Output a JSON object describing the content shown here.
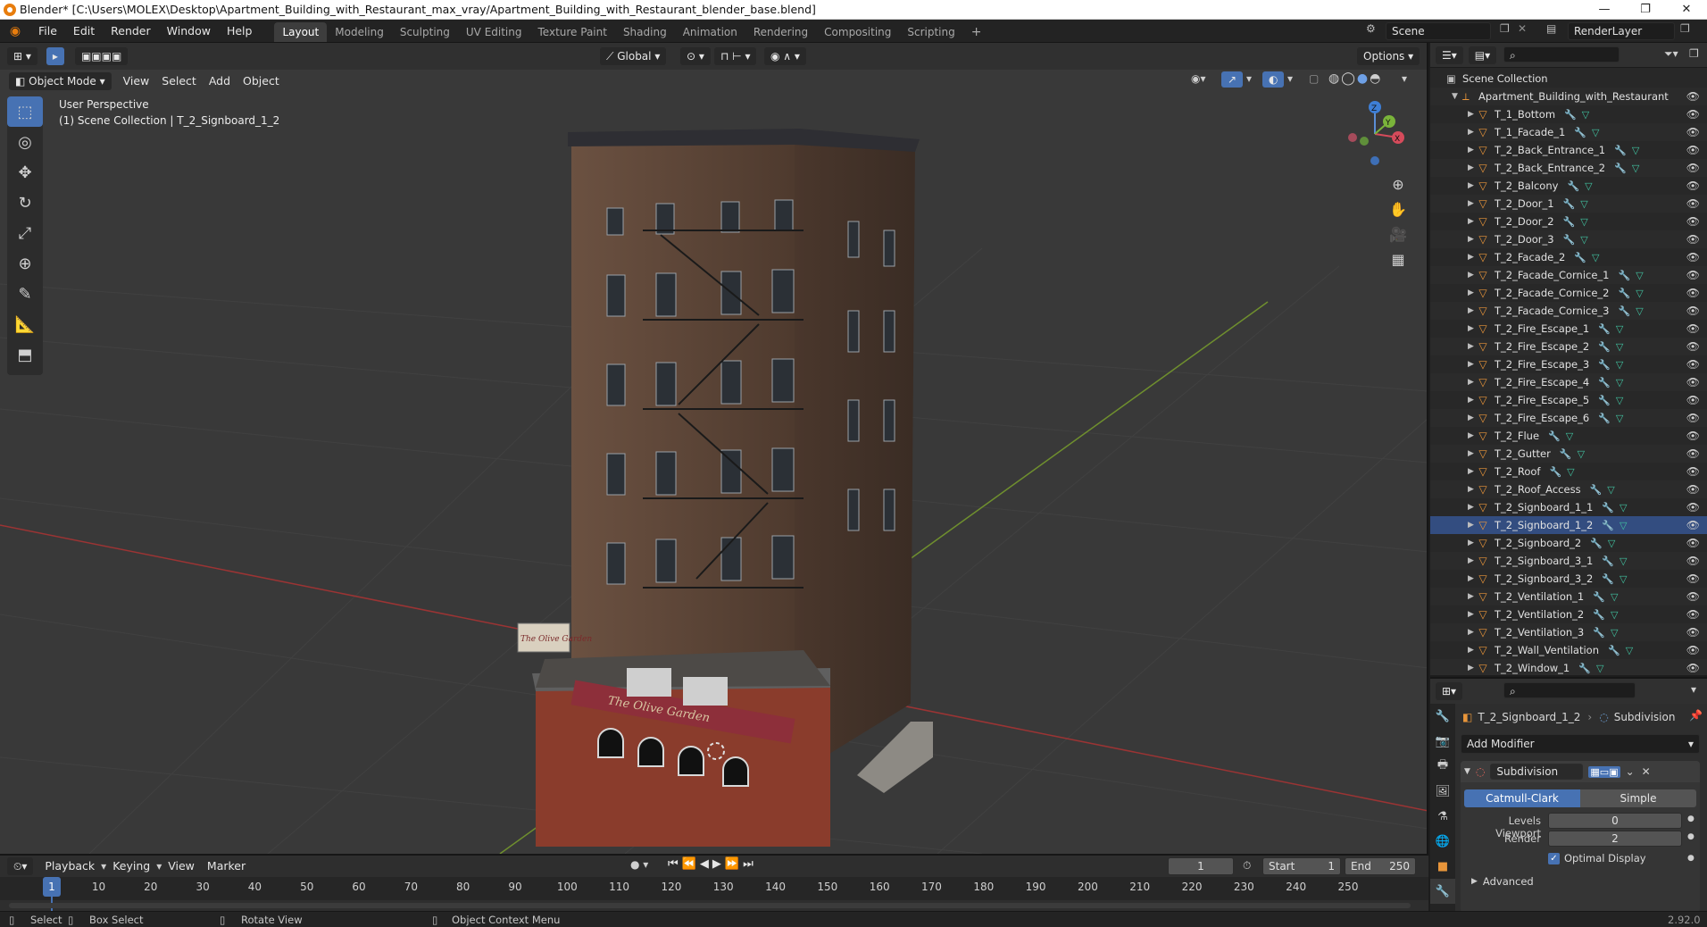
{
  "window": {
    "title": "Blender* [C:\\Users\\MOLEX\\Desktop\\Apartment_Building_with_Restaurant_max_vray/Apartment_Building_with_Restaurant_blender_base.blend]",
    "minimize": "—",
    "maximize": "❐",
    "close": "✕"
  },
  "menubar": {
    "items": [
      "File",
      "Edit",
      "Render",
      "Window",
      "Help"
    ]
  },
  "workspaces": {
    "tabs": [
      "Layout",
      "Modeling",
      "Sculpting",
      "UV Editing",
      "Texture Paint",
      "Shading",
      "Animation",
      "Rendering",
      "Compositing",
      "Scripting"
    ],
    "active": "Layout",
    "add": "+"
  },
  "scene": {
    "name": "Scene",
    "view_layer": "RenderLayer"
  },
  "viewport": {
    "transform_orientation": "Global",
    "options_label": "Options",
    "mode": "Object Mode",
    "menus": [
      "View",
      "Select",
      "Add",
      "Object"
    ],
    "overlay_line1": "User Perspective",
    "overlay_line2": "(1) Scene Collection | T_2_Signboard_1_2",
    "signboard_1": "The Olive Garden",
    "signboard_2": "The Olive Garden",
    "gizmo": {
      "x": "X",
      "y": "Y",
      "z": "Z"
    }
  },
  "outliner": {
    "root": "Scene Collection",
    "collection": "Apartment_Building_with_Restaurant",
    "search_placeholder": "",
    "items": [
      "T_1_Bottom",
      "T_1_Facade_1",
      "T_2_Back_Entrance_1",
      "T_2_Back_Entrance_2",
      "T_2_Balcony",
      "T_2_Door_1",
      "T_2_Door_2",
      "T_2_Door_3",
      "T_2_Facade_2",
      "T_2_Facade_Cornice_1",
      "T_2_Facade_Cornice_2",
      "T_2_Facade_Cornice_3",
      "T_2_Fire_Escape_1",
      "T_2_Fire_Escape_2",
      "T_2_Fire_Escape_3",
      "T_2_Fire_Escape_4",
      "T_2_Fire_Escape_5",
      "T_2_Fire_Escape_6",
      "T_2_Flue",
      "T_2_Gutter",
      "T_2_Roof",
      "T_2_Roof_Access",
      "T_2_Signboard_1_1",
      "T_2_Signboard_1_2",
      "T_2_Signboard_2",
      "T_2_Signboard_3_1",
      "T_2_Signboard_3_2",
      "T_2_Ventilation_1",
      "T_2_Ventilation_2",
      "T_2_Ventilation_3",
      "T_2_Wall_Ventilation",
      "T_2_Window_1"
    ],
    "selected": "T_2_Signboard_1_2"
  },
  "properties": {
    "object_name": "T_2_Signboard_1_2",
    "modifier_crumb": "Subdivision",
    "add_modifier": "Add Modifier",
    "modifier": {
      "name": "Subdivision",
      "type_options": [
        "Catmull-Clark",
        "Simple"
      ],
      "type_selected": "Catmull-Clark",
      "levels_viewport_label": "Levels Viewport",
      "levels_viewport": "0",
      "render_label": "Render",
      "render": "2",
      "optimal_display_label": "Optimal Display",
      "optimal_display": true,
      "advanced_label": "Advanced"
    }
  },
  "timeline": {
    "menus": [
      "Playback",
      "Keying",
      "View",
      "Marker"
    ],
    "current_frame": "1",
    "start_label": "Start",
    "start": "1",
    "end_label": "End",
    "end": "250",
    "ticks": [
      "1",
      "10",
      "20",
      "30",
      "40",
      "50",
      "60",
      "70",
      "80",
      "90",
      "100",
      "110",
      "120",
      "130",
      "140",
      "150",
      "160",
      "170",
      "180",
      "190",
      "200",
      "210",
      "220",
      "230",
      "240",
      "250"
    ]
  },
  "statusbar": {
    "select": "Select",
    "box_select": "Box Select",
    "rotate_view": "Rotate View",
    "context_menu": "Object Context Menu",
    "version": "2.92.0"
  },
  "colors": {
    "accent": "#4772b3",
    "selection": "#334d80",
    "object_orange": "#e8953a",
    "mesh_green": "#41c2a0",
    "modifier_blue": "#6fa2d8"
  }
}
